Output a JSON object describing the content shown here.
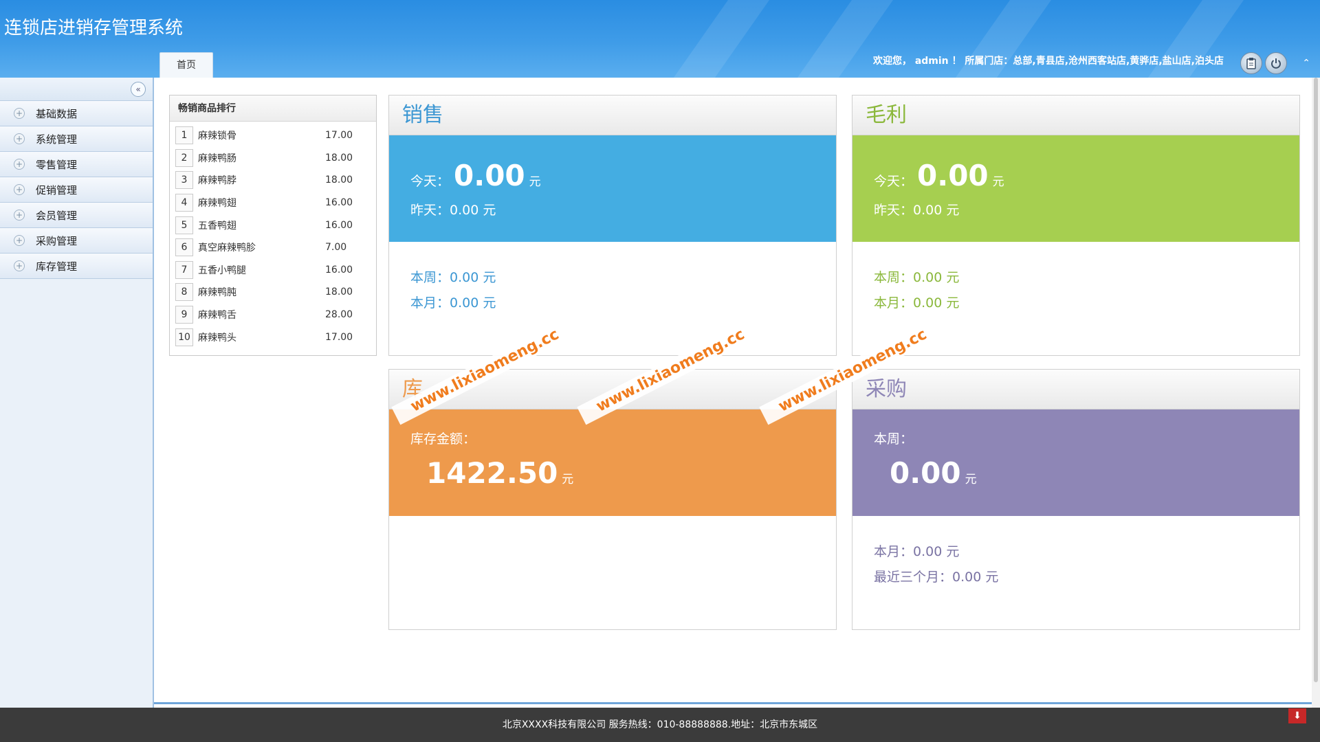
{
  "app": {
    "title": "连锁店进销存管理系统"
  },
  "tabs": [
    {
      "label": "首页"
    }
  ],
  "header": {
    "welcome": "欢迎您， admin ！ 所属门店：总部,青县店,沧州西客站店,黄骅店,盐山店,泊头店",
    "icons": [
      "clipboard-icon",
      "power-icon",
      "chevron-up-icon"
    ]
  },
  "sidebar": {
    "items": [
      {
        "label": "基础数据"
      },
      {
        "label": "系统管理"
      },
      {
        "label": "零售管理"
      },
      {
        "label": "促销管理"
      },
      {
        "label": "会员管理"
      },
      {
        "label": "采购管理"
      },
      {
        "label": "库存管理"
      }
    ]
  },
  "ranking": {
    "title": "畅销商品排行",
    "rows": [
      {
        "no": "1",
        "name": "麻辣锁骨",
        "value": "17.00"
      },
      {
        "no": "2",
        "name": "麻辣鸭肠",
        "value": "18.00"
      },
      {
        "no": "3",
        "name": "麻辣鸭脖",
        "value": "18.00"
      },
      {
        "no": "4",
        "name": "麻辣鸭翅",
        "value": "16.00"
      },
      {
        "no": "5",
        "name": "五香鸭翅",
        "value": "16.00"
      },
      {
        "no": "6",
        "name": "真空麻辣鸭胗",
        "value": "7.00"
      },
      {
        "no": "7",
        "name": "五香小鸭腿",
        "value": "16.00"
      },
      {
        "no": "8",
        "name": "麻辣鸭肫",
        "value": "18.00"
      },
      {
        "no": "9",
        "name": "麻辣鸭舌",
        "value": "28.00"
      },
      {
        "no": "10",
        "name": "麻辣鸭头",
        "value": "17.00"
      }
    ]
  },
  "cards": {
    "sales": {
      "title": "销售",
      "color": "#44ade2",
      "today_label": "今天：",
      "today_value": "0.00",
      "unit": "元",
      "yesterday": "昨天：0.00 元",
      "week": "本周：0.00 元",
      "month": "本月：0.00 元"
    },
    "profit": {
      "title": "毛利",
      "color": "#a6cf50",
      "today_label": "今天：",
      "today_value": "0.00",
      "unit": "元",
      "yesterday": "昨天：0.00 元",
      "week": "本周：0.00 元",
      "month": "本月：0.00 元"
    },
    "inventory": {
      "title": "库",
      "color": "#ee9a4c",
      "amount_label": "库存金额：",
      "amount_value": "1422.50",
      "unit": "元"
    },
    "purchase": {
      "title": "采购",
      "color": "#8e86b6",
      "week_label": "本周：",
      "week_value": "0.00",
      "unit": "元",
      "month": "本月：0.00 元",
      "quarter": "最近三个月：0.00 元"
    }
  },
  "watermark": "www.lixiaomeng.cc",
  "footer": {
    "text": "北京XXXX科技有限公司 服务热线：010-88888888.地址：北京市东城区"
  }
}
